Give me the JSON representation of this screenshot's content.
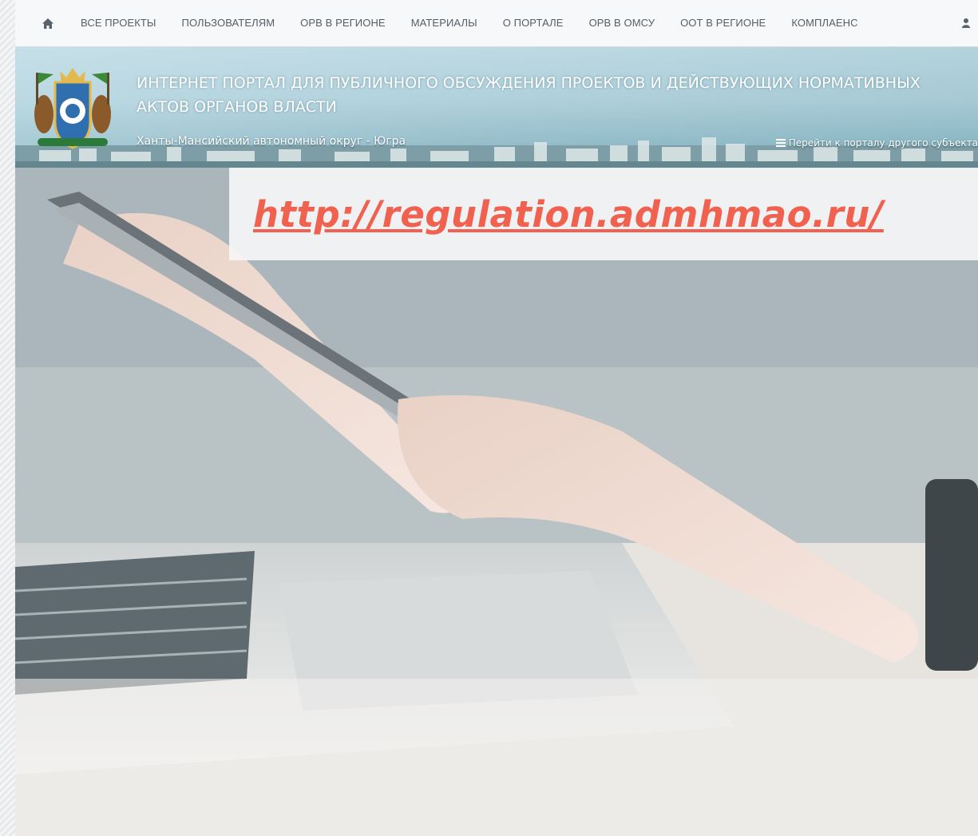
{
  "nav": {
    "home_icon": "home-icon",
    "items": [
      {
        "label": "ВСЕ ПРОЕКТЫ"
      },
      {
        "label": "ПОЛЬЗОВАТЕЛЯМ"
      },
      {
        "label": "ОРВ В РЕГИОНЕ"
      },
      {
        "label": "МАТЕРИАЛЫ"
      },
      {
        "label": "О ПОРТАЛЕ"
      },
      {
        "label": "ОРВ В ОМСУ"
      },
      {
        "label": "ООТ В РЕГИОНЕ"
      },
      {
        "label": "КОМПЛАЕНС"
      }
    ],
    "user_icon": "user-icon"
  },
  "header": {
    "title": "ИНТЕРНЕТ ПОРТАЛ ДЛЯ ПУБЛИЧНОГО ОБСУЖДЕНИЯ ПРОЕКТОВ И ДЕЙСТВУЮЩИХ НОРМАТИВНЫХ АКТОВ ОРГАНОВ ВЛАСТИ",
    "region": "Ханты-Мансийский автономный округ - Югра",
    "switch_portal": "Перейти к порталу другого субъекта",
    "emblem_icon": "coat-of-arms-icon"
  },
  "hero": {
    "url": "http://regulation.admhmao.ru/"
  },
  "colors": {
    "url_accent": "#f0624f",
    "nav_text": "#555d63"
  }
}
